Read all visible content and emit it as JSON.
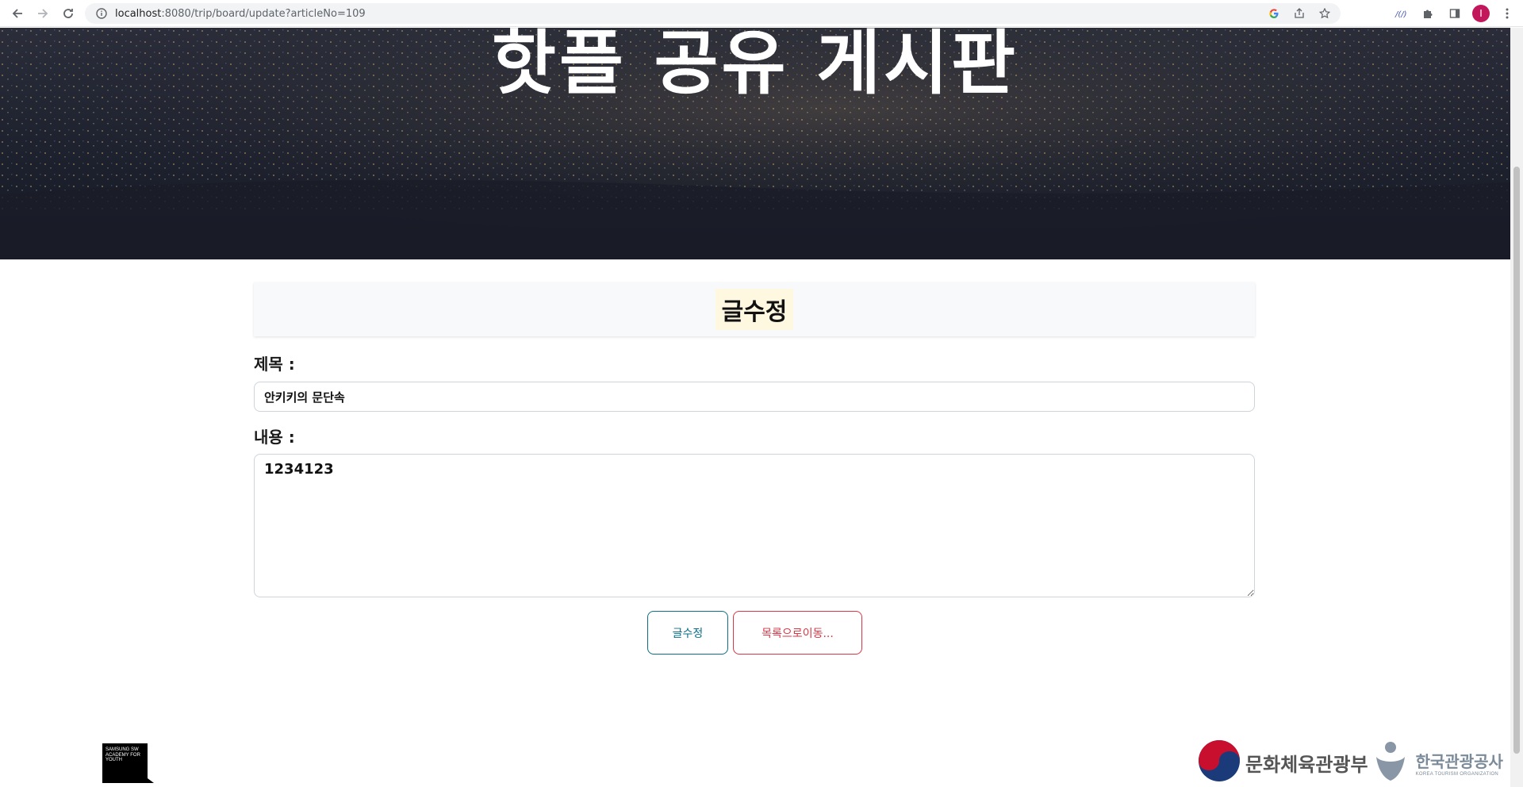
{
  "browser": {
    "url_host": "localhost",
    "url_path": ":8080/trip/board/update?articleNo=109",
    "avatar_letter": "I",
    "icons": [
      "back-icon",
      "forward-icon",
      "reload-icon",
      "info-icon",
      "google-icon",
      "share-icon",
      "star-icon",
      "extension-icon",
      "puzzle-icon",
      "side-panel-icon",
      "menu-icon"
    ]
  },
  "hero": {
    "title": "핫플 공유 게시판"
  },
  "form": {
    "heading": "글수정",
    "title_label": "제목 :",
    "title_value": "안키키의 문단속",
    "content_label": "내용 :",
    "content_value": "1234123",
    "submit_label": "글수정",
    "list_label": "목록으로이동..."
  },
  "footer": {
    "left_logo_text": "SAMSUNG SW ACADEMY FOR YOUTH",
    "mcst_name": "문화체육관광부",
    "kto_name": "한국관광공사",
    "kto_sub": "KOREA TOURISM ORGANIZATION"
  },
  "colors": {
    "edit_button": "#0d6e8a",
    "list_button": "#dc3545",
    "title_highlight": "#fff8e1"
  }
}
